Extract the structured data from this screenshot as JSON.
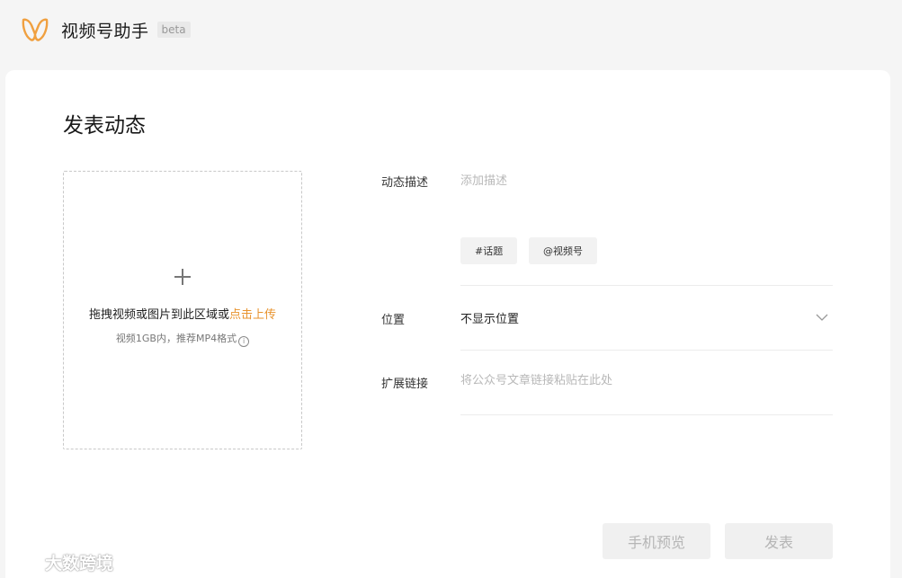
{
  "header": {
    "title": "视频号助手",
    "badge": "beta"
  },
  "page": {
    "title": "发表动态"
  },
  "upload": {
    "main_text": "拖拽视频或图片到此区域或",
    "link_text": "点击上传",
    "sub_text": "视频1GB内，推荐MP4格式",
    "info_glyph": "i"
  },
  "form": {
    "description": {
      "label": "动态描述",
      "placeholder": "添加描述"
    },
    "tags": {
      "topic_label": "#话题",
      "mention_label": "@视频号"
    },
    "location": {
      "label": "位置",
      "value": "不显示位置"
    },
    "extension": {
      "label": "扩展链接",
      "placeholder": "将公众号文章链接粘贴在此处"
    }
  },
  "actions": {
    "preview_label": "手机预览",
    "publish_label": "发表"
  },
  "watermark": {
    "text": "大数跨境"
  },
  "colors": {
    "accent": "#e8932e",
    "background": "#f5f5f5",
    "card": "#ffffff",
    "disabled_button_bg": "#f0f0f0",
    "disabled_button_text": "#b5b5b5"
  },
  "icons": {
    "logo": "wechat-channels-logo-icon",
    "plus": "plus-icon",
    "info": "info-icon",
    "chevron": "chevron-down-icon"
  }
}
